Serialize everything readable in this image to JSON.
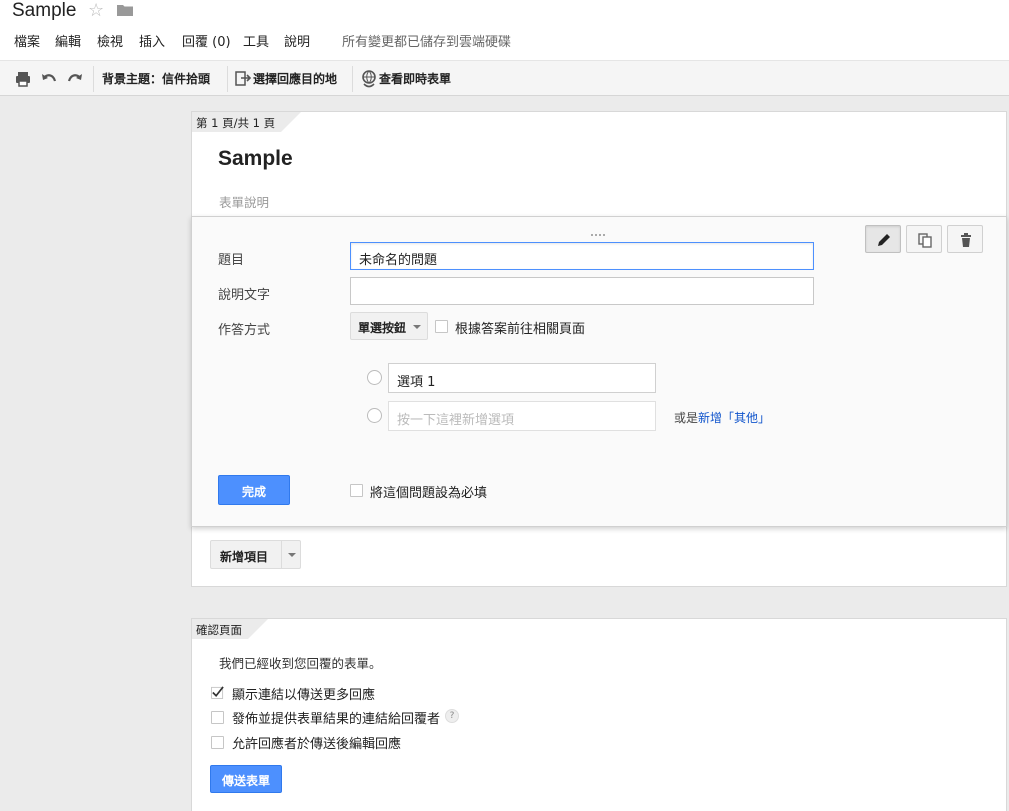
{
  "app": {
    "doc_title": "Sample",
    "save_status": "所有變更都已儲存到雲端硬碟"
  },
  "menu": [
    "檔案",
    "編輯",
    "檢視",
    "插入",
    "回覆 (0)",
    "工具",
    "說明"
  ],
  "toolbar": {
    "theme": "背景主題：信件拾頭",
    "choose_destination": "選擇回應目的地",
    "view_live_form": "查看即時表單"
  },
  "page1": {
    "tag": "第 1 頁/共 1 頁",
    "form_title": "Sample",
    "form_description_placeholder": "表單說明"
  },
  "question": {
    "title_label": "題目",
    "title_value": "未命名的問題",
    "help_label": "說明文字",
    "help_value": "",
    "type_label": "作答方式",
    "type_value": "單選按鈕",
    "goto_page_label": "根據答案前往相關頁面",
    "option1": "選項 1",
    "add_option_placeholder": "按一下這裡新增選項",
    "or_text": "或是",
    "add_other": "新增「其他」",
    "done": "完成",
    "required_label": "將這個問題設為必填"
  },
  "add_item": "新增項目",
  "confirm": {
    "tag": "確認頁面",
    "message": "我們已經收到您回覆的表單。",
    "opt_show_link": "顯示連結以傳送更多回應",
    "opt_show_link_checked": true,
    "opt_publish": "發佈並提供表單結果的連結給回覆者",
    "opt_publish_checked": false,
    "opt_edit": "允許回應者於傳送後編輯回應",
    "opt_edit_checked": false,
    "submit": "傳送表單"
  },
  "colors": {
    "accent": "#4d90fe",
    "link": "#1155cc",
    "background": "#ebebeb"
  },
  "icons": [
    "star-icon",
    "folder-icon",
    "print-icon",
    "undo-icon",
    "redo-icon",
    "destination-icon",
    "live-form-icon",
    "pencil-icon",
    "duplicate-icon",
    "trash-icon",
    "help-icon"
  ]
}
